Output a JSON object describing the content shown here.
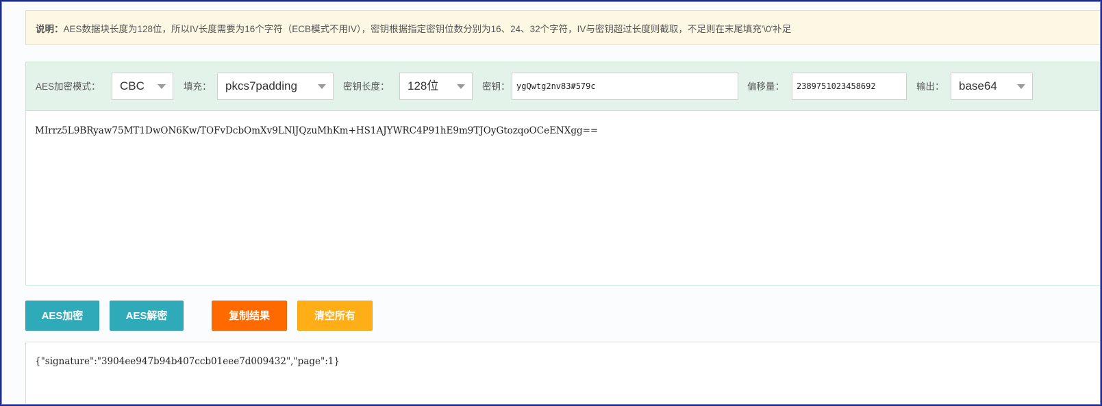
{
  "note": {
    "label": "说明：",
    "text": "AES数据块长度为128位，所以IV长度需要为16个字符（ECB模式不用IV），密钥根据指定密钥位数分别为16、24、32个字符，IV与密钥超过长度则截取，不足则在末尾填充'\\0'补足"
  },
  "toolbar": {
    "mode_label": "AES加密模式：",
    "mode_value": "CBC",
    "padding_label": "填充：",
    "padding_value": "pkcs7padding",
    "keylen_label": "密钥长度：",
    "keylen_value": "128位",
    "key_label": "密钥：",
    "key_value": "ygQwtg2nv83#579c",
    "iv_label": "偏移量：",
    "iv_value": "2389751023458692",
    "output_label": "输出：",
    "output_value": "base64"
  },
  "input": {
    "text": "MIrrz5L9BRyaw75MT1DwON6Kw/TOFvDcbOmXv9LNlJQzuMhKm+HS1AJYWRC4P91hE9m9TJOyGtozqoOCeENXgg=="
  },
  "buttons": {
    "encrypt": "AES加密",
    "decrypt": "AES解密",
    "copy": "复制结果",
    "clear": "清空所有"
  },
  "output": {
    "text": "{\"signature\":\"3904ee947b94b407ccb01eee7d009432\",\"page\":1}"
  }
}
